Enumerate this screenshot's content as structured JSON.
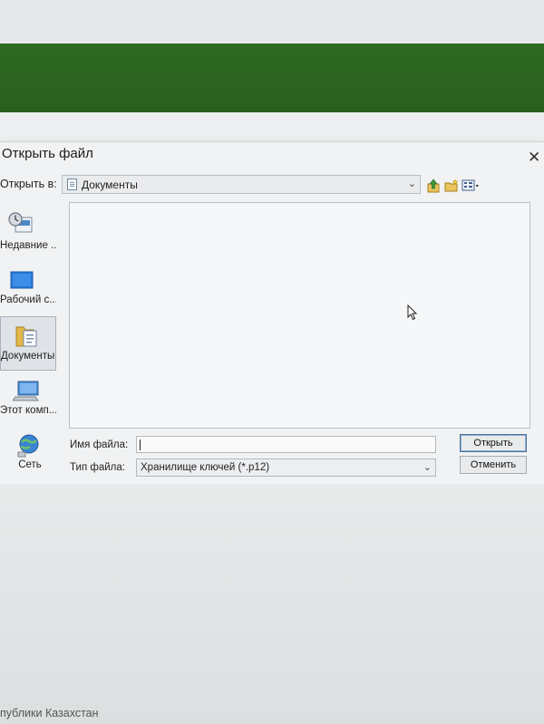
{
  "dialog": {
    "title": "Открыть файл",
    "close_glyph": "✕",
    "look_in_label": "Открыть в:",
    "look_in_value": "Документы",
    "toolbar_icons": [
      "up-folder-icon",
      "new-folder-icon",
      "view-menu-icon"
    ],
    "places": [
      {
        "label": "Недавние ...",
        "icon": "recent-places-icon"
      },
      {
        "label": "Рабочий с...",
        "icon": "desktop-icon"
      },
      {
        "label": "Документы",
        "icon": "documents-icon",
        "selected": true
      },
      {
        "label": "Этот комп...",
        "icon": "this-pc-icon"
      },
      {
        "label": "Сеть",
        "icon": "network-icon"
      }
    ],
    "file_name_label": "Имя файла:",
    "file_name_value": "",
    "file_type_label": "Тип файла:",
    "file_type_value": "Хранилище ключей (*.p12)",
    "open_button": "Открыть",
    "cancel_button": "Отменить",
    "dropdown_glyph": "⌄"
  },
  "footer": {
    "text": "публики Казахстан"
  },
  "colors": {
    "header_green": "#2e6a22",
    "dialog_bg": "#f1f2f3",
    "accent_border": "#4c6f9b"
  }
}
